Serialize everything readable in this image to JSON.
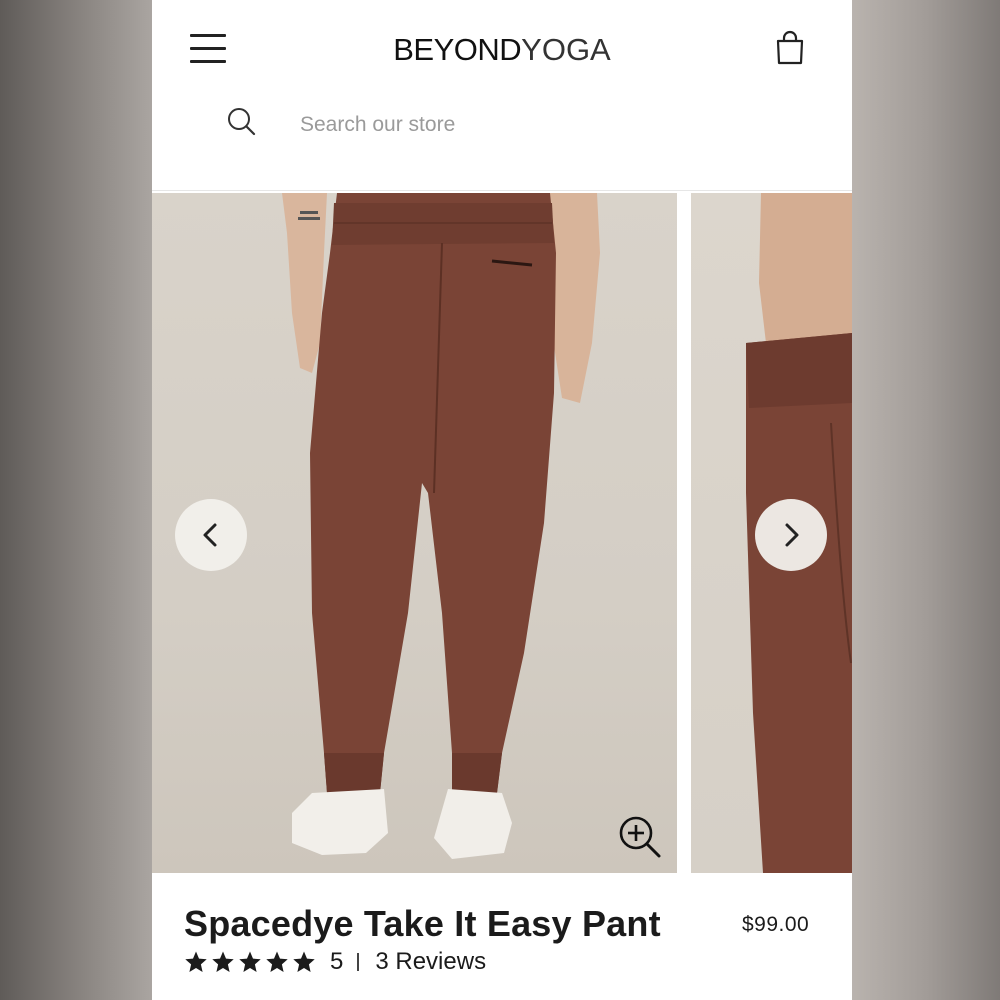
{
  "header": {
    "logo_primary": "BEYOND",
    "logo_secondary": "YOGA"
  },
  "search": {
    "placeholder": "Search our store",
    "value": ""
  },
  "product": {
    "title": "Spacedye Take It Easy Pant",
    "price": "$99.00",
    "rating_stars": 5,
    "rating_value": "5",
    "reviews": "3 Reviews"
  },
  "colors": {
    "pant": "#7a4436",
    "text": "#1b1b1b",
    "placeholder": "#9a9a9a"
  },
  "icons": {
    "menu": "hamburger-menu-icon",
    "cart": "shopping-bag-icon",
    "search": "search-icon",
    "prev": "chevron-left-icon",
    "next": "chevron-right-icon",
    "zoom": "zoom-in-icon",
    "star": "star-icon"
  }
}
